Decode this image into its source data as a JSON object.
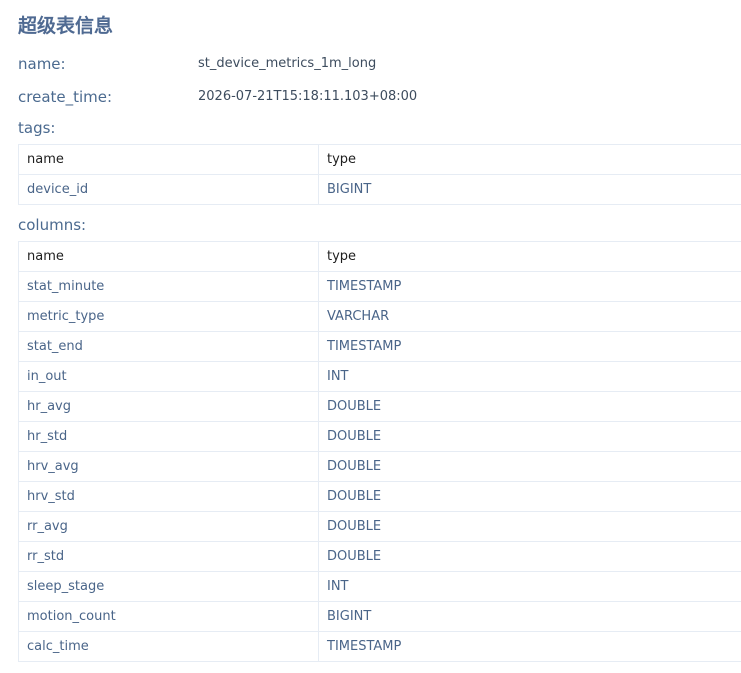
{
  "title": "超级表信息",
  "info": {
    "name_label": "name:",
    "name_value": "st_device_metrics_1m_long",
    "create_time_label": "create_time:",
    "create_time_value": "2026-07-21T15:18:11.103+08:00"
  },
  "tags": {
    "label": "tags:",
    "headers": {
      "name": "name",
      "type": "type"
    },
    "rows": [
      {
        "name": "device_id",
        "type": "BIGINT"
      }
    ]
  },
  "columns": {
    "label": "columns:",
    "headers": {
      "name": "name",
      "type": "type"
    },
    "rows": [
      {
        "name": "stat_minute",
        "type": "TIMESTAMP"
      },
      {
        "name": "metric_type",
        "type": "VARCHAR"
      },
      {
        "name": "stat_end",
        "type": "TIMESTAMP"
      },
      {
        "name": "in_out",
        "type": "INT"
      },
      {
        "name": "hr_avg",
        "type": "DOUBLE"
      },
      {
        "name": "hr_std",
        "type": "DOUBLE"
      },
      {
        "name": "hrv_avg",
        "type": "DOUBLE"
      },
      {
        "name": "hrv_std",
        "type": "DOUBLE"
      },
      {
        "name": "rr_avg",
        "type": "DOUBLE"
      },
      {
        "name": "rr_std",
        "type": "DOUBLE"
      },
      {
        "name": "sleep_stage",
        "type": "INT"
      },
      {
        "name": "motion_count",
        "type": "BIGINT"
      },
      {
        "name": "calc_time",
        "type": "TIMESTAMP"
      }
    ]
  }
}
